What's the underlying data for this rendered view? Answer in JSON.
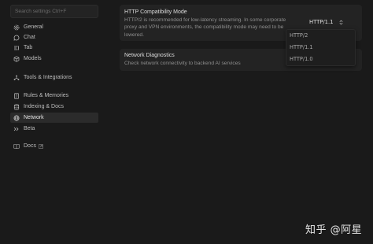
{
  "sidebar": {
    "search_placeholder": "Search settings Ctrl+F",
    "items": [
      {
        "label": "General",
        "icon": "gear-icon"
      },
      {
        "label": "Chat",
        "icon": "chat-icon"
      },
      {
        "label": "Tab",
        "icon": "tab-icon"
      },
      {
        "label": "Models",
        "icon": "cube-icon"
      },
      {
        "label": "Tools & Integrations",
        "icon": "tools-icon"
      },
      {
        "label": "Rules & Memories",
        "icon": "document-icon"
      },
      {
        "label": "Indexing & Docs",
        "icon": "database-icon"
      },
      {
        "label": "Network",
        "icon": "globe-icon",
        "active": true
      },
      {
        "label": "Beta",
        "icon": "beta-icon"
      },
      {
        "label": "Docs",
        "icon": "book-icon"
      }
    ]
  },
  "main": {
    "http_compat": {
      "title": "HTTP Compatibility Mode",
      "description": "HTTP/2 is recommended for low-latency streaming. In some corporate proxy and VPN environments, the compatibility mode may need to be lowered.",
      "selected": "HTTP/1.1",
      "options": [
        "HTTP/2",
        "HTTP/1.1",
        "HTTP/1.0"
      ]
    },
    "network_diag": {
      "title": "Network Diagnostics",
      "description": "Check network connectivity to backend AI services"
    }
  },
  "watermark": "知乎 @阿星",
  "colors": {
    "background": "#1a1a1a",
    "card": "#232323",
    "active_item": "#2b2b2b"
  }
}
